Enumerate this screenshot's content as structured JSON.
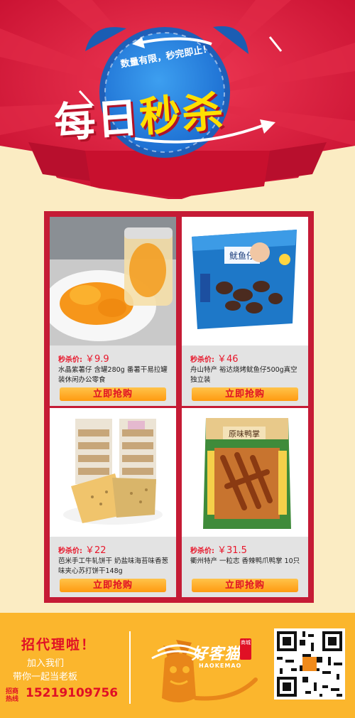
{
  "header": {
    "slogan": "数量有限，秒完即止！",
    "title_part1": "每日",
    "title_part2": "秒",
    "title_part3": "杀"
  },
  "products": [
    {
      "price_label": "秒杀价:",
      "price": "￥9.9",
      "desc": "水晶紫薯仔 含罐280g 番薯干易拉罐装休闲办公零食",
      "button": "立即抢购",
      "image_name": "sweet-potato-candy-image"
    },
    {
      "price_label": "秒杀价:",
      "price": "￥46",
      "desc": "舟山特产 裕达烧烤鱿鱼仔500g真空独立装",
      "button": "立即抢购",
      "image_name": "squid-snack-bag-image"
    },
    {
      "price_label": "秒杀价:",
      "price": "￥22",
      "desc": "芭米手工牛轧饼干 奶盐味海苔味香葱味夹心苏打饼干148g",
      "button": "立即抢购",
      "image_name": "nougat-biscuit-image"
    },
    {
      "price_label": "秒杀价:",
      "price": "￥31.5",
      "desc": "衢州特产 一粒志 香辣鸭爪鸭掌 10只",
      "button": "立即抢购",
      "image_name": "duck-feet-package-image"
    }
  ],
  "product_images": {
    "p1_tag": "",
    "p2_bag_label": "鱿鱼仔",
    "p4_bag_label": "原味鸭掌"
  },
  "footer": {
    "title": "招代理啦！",
    "line1": "加入我们",
    "line2": "带你一起当老板",
    "hotline_label": "招商热线",
    "phone": "15219109756",
    "logo_text": "好客猫",
    "logo_stamp": "商城",
    "logo_en": "HAOKEMAO"
  },
  "colors": {
    "header_red": "#d3163a",
    "board_red": "#c51b35",
    "accent_yellow": "#ffe000",
    "footer_orange": "#fbb62d",
    "button_orange": "#ff9a10",
    "price_red": "#e8162a"
  }
}
